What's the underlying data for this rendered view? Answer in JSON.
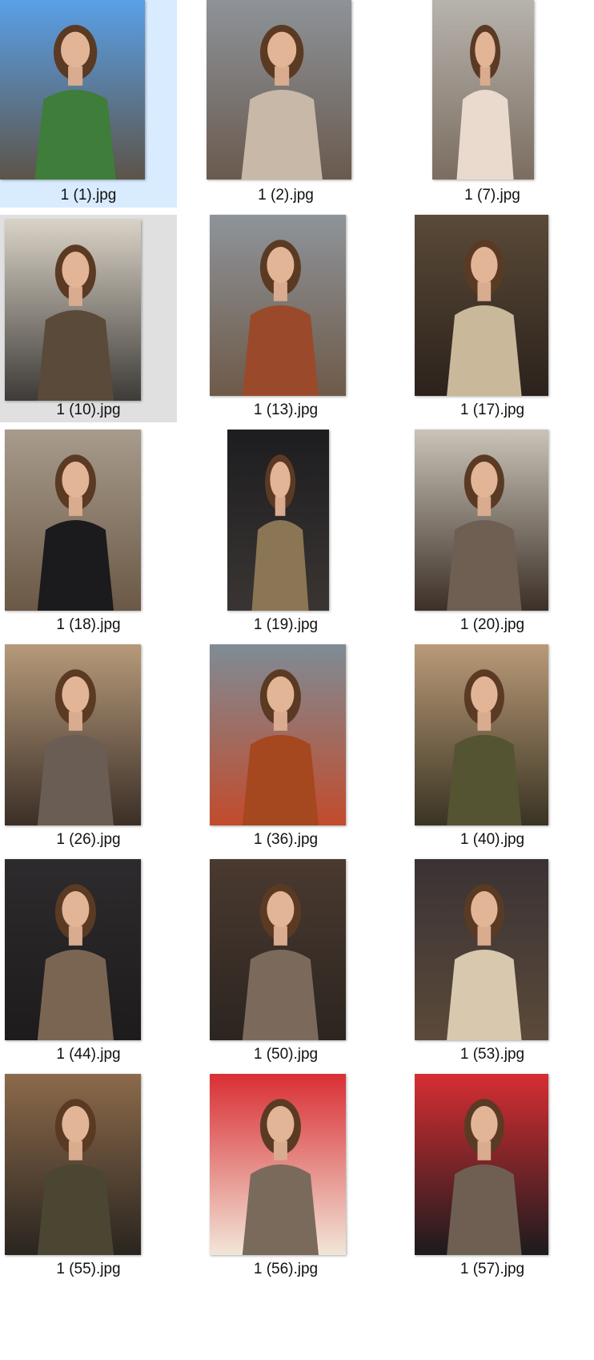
{
  "files": [
    {
      "name": "1 (1).jpg",
      "state": "selected",
      "image_icon": "photo-icon",
      "colors": [
        "#5aa0e8",
        "#3f7d3a",
        "#5c5448"
      ]
    },
    {
      "name": "1 (2).jpg",
      "state": "normal",
      "image_icon": "photo-icon",
      "colors": [
        "#8d9399",
        "#c7b8a8",
        "#6a5a4e"
      ]
    },
    {
      "name": "1 (7).jpg",
      "state": "normal",
      "image_icon": "photo-icon",
      "colors": [
        "#b7b3ad",
        "#e9dacd",
        "#7b6d60"
      ]
    },
    {
      "name": "1 (10).jpg",
      "state": "hovered",
      "image_icon": "photo-icon",
      "colors": [
        "#d9d2c6",
        "#5a4a3a",
        "#3e3b38"
      ]
    },
    {
      "name": "1 (13).jpg",
      "state": "normal",
      "image_icon": "photo-icon",
      "colors": [
        "#8e949a",
        "#9a4a2a",
        "#6e5a48"
      ]
    },
    {
      "name": "1 (17).jpg",
      "state": "normal",
      "image_icon": "photo-icon",
      "colors": [
        "#5a4a38",
        "#c9b89a",
        "#2c221c"
      ]
    },
    {
      "name": "1 (18).jpg",
      "state": "normal",
      "image_icon": "photo-icon",
      "colors": [
        "#a79b8b",
        "#1b1b1d",
        "#6b5846"
      ]
    },
    {
      "name": "1 (19).jpg",
      "state": "normal",
      "image_icon": "photo-icon",
      "colors": [
        "#1d1d20",
        "#8a7654",
        "#3a3532"
      ]
    },
    {
      "name": "1 (20).jpg",
      "state": "normal",
      "image_icon": "photo-icon",
      "colors": [
        "#c9c3b8",
        "#6e5f52",
        "#3c3027"
      ]
    },
    {
      "name": "1 (26).jpg",
      "state": "normal",
      "image_icon": "photo-icon",
      "colors": [
        "#b69a7a",
        "#6a5d53",
        "#3b2f27"
      ]
    },
    {
      "name": "1 (36).jpg",
      "state": "normal",
      "image_icon": "photo-icon",
      "colors": [
        "#7e8c96",
        "#a5471f",
        "#c24b2c"
      ]
    },
    {
      "name": "1 (40).jpg",
      "state": "normal",
      "image_icon": "photo-icon",
      "colors": [
        "#b99a78",
        "#545432",
        "#3a3423"
      ]
    },
    {
      "name": "1 (44).jpg",
      "state": "normal",
      "image_icon": "photo-icon",
      "colors": [
        "#2d2b2d",
        "#7a6553",
        "#1d1b1b"
      ]
    },
    {
      "name": "1 (50).jpg",
      "state": "normal",
      "image_icon": "photo-icon",
      "colors": [
        "#4a3a30",
        "#7b6a5b",
        "#2c2520"
      ]
    },
    {
      "name": "1 (53).jpg",
      "state": "normal",
      "image_icon": "photo-icon",
      "colors": [
        "#3a3234",
        "#d8c9ae",
        "#5b4a3a"
      ]
    },
    {
      "name": "1 (55).jpg",
      "state": "normal",
      "image_icon": "photo-icon",
      "colors": [
        "#8c6a4a",
        "#4a4632",
        "#2a2520"
      ]
    },
    {
      "name": "1 (56).jpg",
      "state": "normal",
      "image_icon": "photo-icon",
      "colors": [
        "#d92f34",
        "#7a6a5c",
        "#f2e6d8"
      ]
    },
    {
      "name": "1 (57).jpg",
      "state": "normal",
      "image_icon": "photo-icon",
      "colors": [
        "#d62e33",
        "#6e5f52",
        "#1b1b1d"
      ]
    }
  ]
}
